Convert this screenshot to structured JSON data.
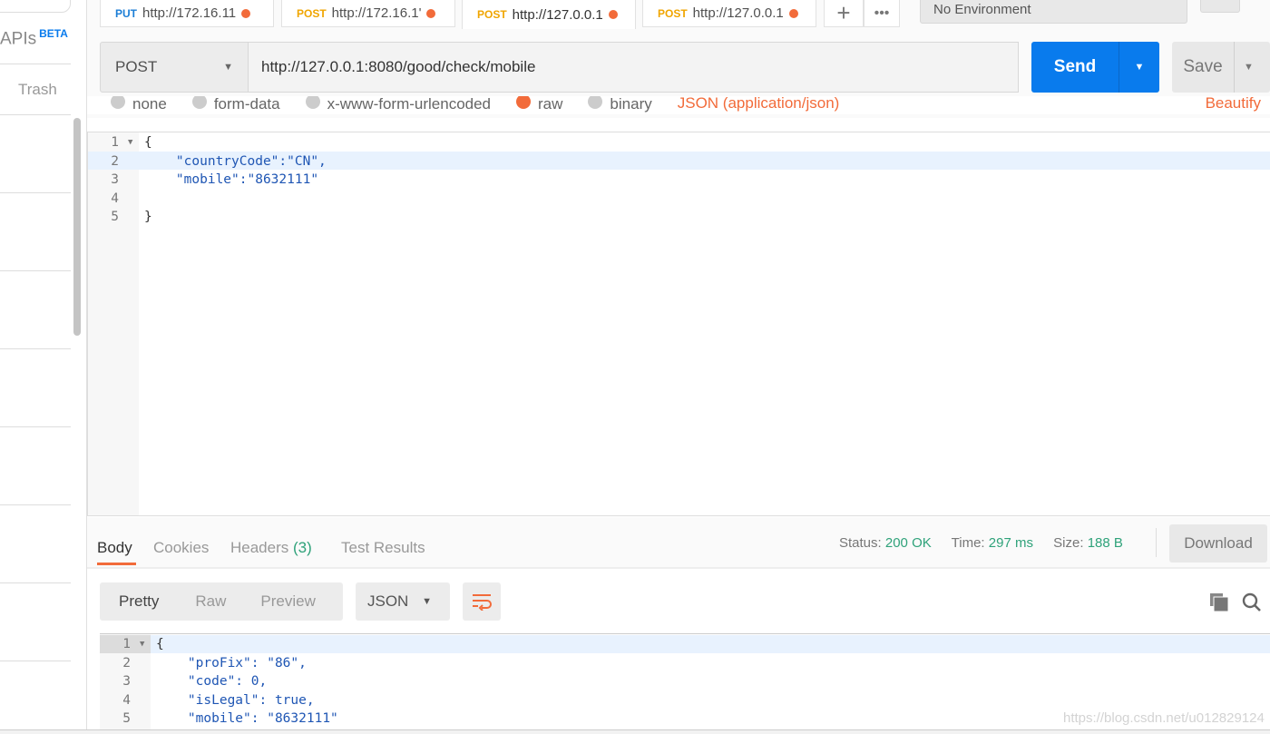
{
  "sidebar": {
    "apis": "APIs",
    "beta": "BETA",
    "trash": "Trash"
  },
  "tabs": [
    {
      "method": "PUT",
      "url": "http://172.16.11",
      "color": "#1c7ed6"
    },
    {
      "method": "POST",
      "url": "http://172.16.1'",
      "color": "#f0a500"
    },
    {
      "method": "POST",
      "url": "http://127.0.0.1",
      "color": "#f0a500"
    },
    {
      "method": "POST",
      "url": "http://127.0.0.1",
      "color": "#f0a500"
    }
  ],
  "environment": "No Environment",
  "request": {
    "method": "POST",
    "url": "http://127.0.0.1:8080/good/check/mobile",
    "send": "Send",
    "save": "Save"
  },
  "body_types": [
    "none",
    "form-data",
    "x-www-form-urlencoded",
    "raw",
    "binary"
  ],
  "content_type": "JSON (application/json)",
  "beautify": "Beautify",
  "request_body": {
    "lines": [
      "1",
      "2",
      "3",
      "4",
      "5"
    ],
    "text": [
      "{",
      "    \"countryCode\":\"CN\",",
      "    \"mobile\":\"8632111\"",
      "",
      "}"
    ]
  },
  "response": {
    "tabs": [
      "Body",
      "Cookies",
      "Headers",
      "(3)",
      "Test Results"
    ],
    "status_label": "Status:",
    "status": "200 OK",
    "time_label": "Time:",
    "time": "297 ms",
    "size_label": "Size:",
    "size": "188 B",
    "download": "Download",
    "views": [
      "Pretty",
      "Raw",
      "Preview"
    ],
    "format": "JSON",
    "lines": [
      "1",
      "2",
      "3",
      "4",
      "5"
    ],
    "text": [
      "{",
      "    \"proFix\": \"86\",",
      "    \"code\": 0,",
      "    \"isLegal\": true,",
      "    \"mobile\": \"8632111\""
    ]
  },
  "watermark": "https://blog.csdn.net/u012829124",
  "colors": {
    "accent": "#097bed",
    "status_green": "#2fa27a",
    "orange": "#f26b3a"
  }
}
